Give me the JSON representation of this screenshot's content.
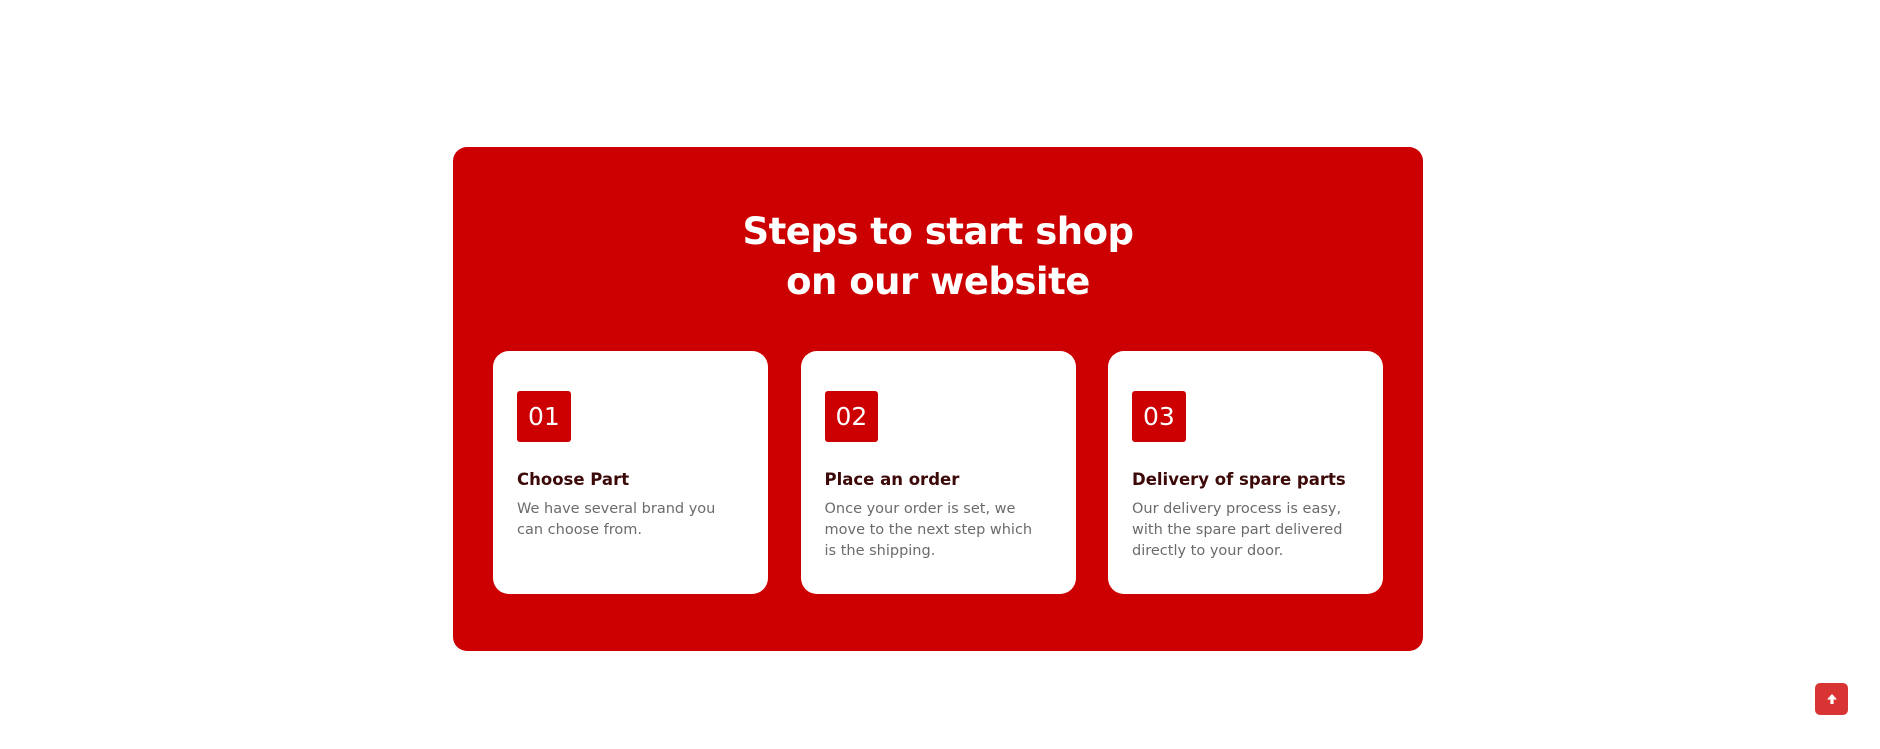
{
  "section": {
    "heading_line1": "Steps to start shop",
    "heading_line2": "on our website",
    "steps": [
      {
        "number": "01",
        "title": "Choose Part",
        "description": "We have several brand you can choose from."
      },
      {
        "number": "02",
        "title": "Place an order",
        "description": "Once your order is set, we move to the next step which is the shipping."
      },
      {
        "number": "03",
        "title": "Delivery of spare parts",
        "description": "Our delivery process is easy, with the spare part delivered directly to your door."
      }
    ]
  },
  "scroll_top": {
    "icon": "arrow-up-icon"
  },
  "colors": {
    "brand_red": "#cc0000",
    "card_background": "#ffffff",
    "title_text": "#3c0808",
    "description_text": "#6b6b6b",
    "scroll_button": "#d93434"
  }
}
